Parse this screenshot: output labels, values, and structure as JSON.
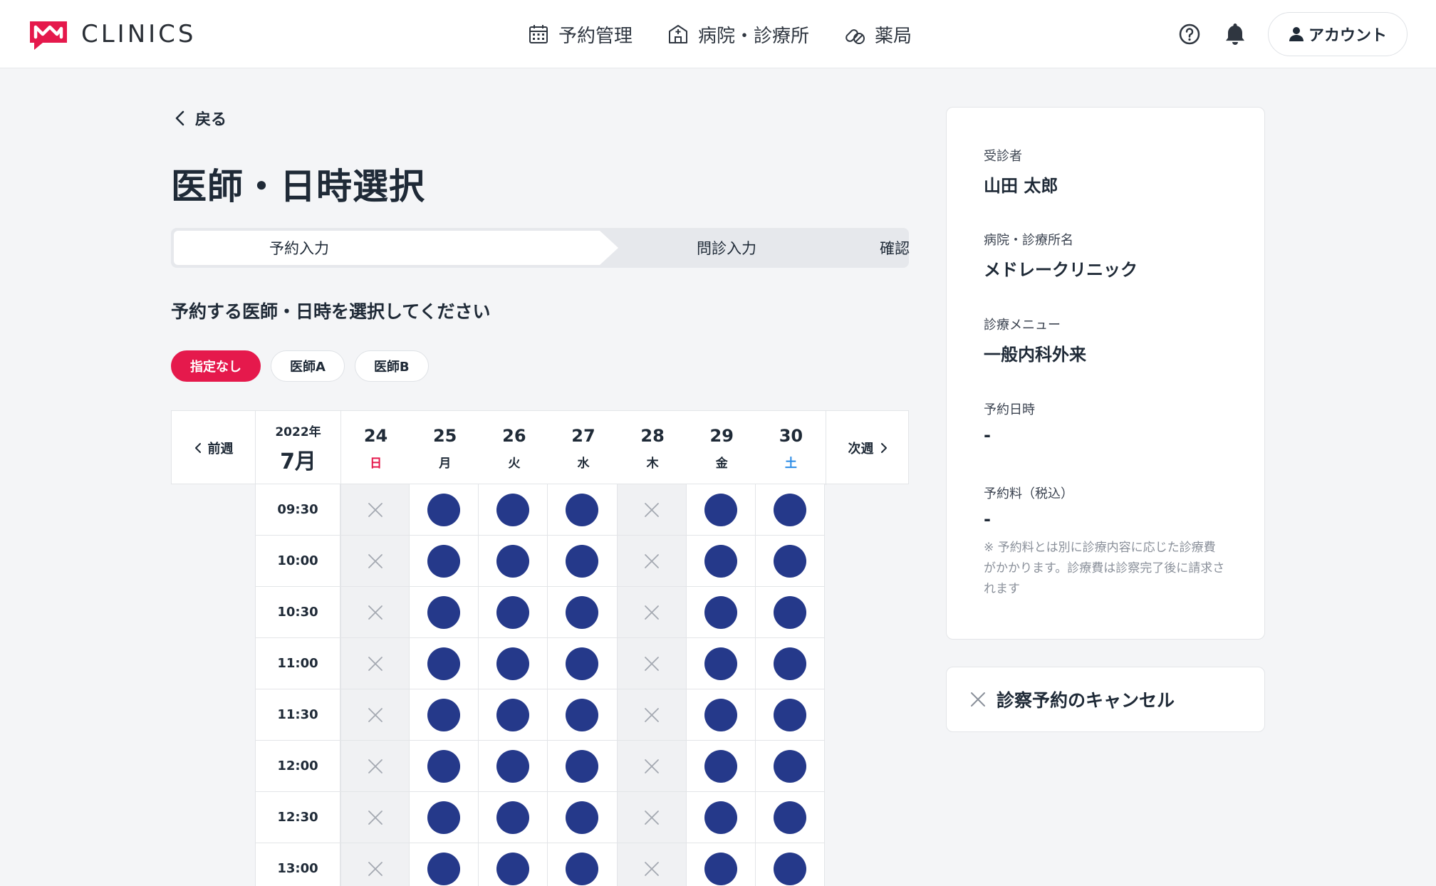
{
  "header": {
    "logo_text": "CLINICS",
    "nav": [
      {
        "label": "予約管理",
        "icon": "calendar-icon"
      },
      {
        "label": "病院・診療所",
        "icon": "hospital-icon"
      },
      {
        "label": "薬局",
        "icon": "pills-icon"
      }
    ],
    "account_label": "アカウント"
  },
  "back_label": "戻る",
  "page_title": "医師・日時選択",
  "steps": [
    "予約入力",
    "問診入力",
    "確認"
  ],
  "subtitle": "予約する医師・日時を選択してください",
  "doctor_chips": [
    "指定なし",
    "医師A",
    "医師B"
  ],
  "calendar": {
    "prev_label": "前週",
    "next_label": "次週",
    "year": "2022年",
    "month": "7月",
    "days": [
      {
        "num": "24",
        "wd": "日",
        "color": "#e5194c",
        "closed": true
      },
      {
        "num": "25",
        "wd": "月",
        "color": "#1f2a37",
        "closed": false
      },
      {
        "num": "26",
        "wd": "火",
        "color": "#1f2a37",
        "closed": false
      },
      {
        "num": "27",
        "wd": "水",
        "color": "#1f2a37",
        "closed": false
      },
      {
        "num": "28",
        "wd": "木",
        "color": "#1f2a37",
        "closed": true
      },
      {
        "num": "29",
        "wd": "金",
        "color": "#1f2a37",
        "closed": false
      },
      {
        "num": "30",
        "wd": "土",
        "color": "#2b8ce6",
        "closed": false
      }
    ],
    "times": [
      "09:30",
      "10:00",
      "10:30",
      "11:00",
      "11:30",
      "12:00",
      "12:30",
      "13:00"
    ]
  },
  "summary": {
    "patient_label": "受診者",
    "patient_value": "山田 太郎",
    "clinic_label": "病院・診療所名",
    "clinic_value": "メドレークリニック",
    "menu_label": "診療メニュー",
    "menu_value": "一般内科外来",
    "datetime_label": "予約日時",
    "datetime_value": "-",
    "fee_label": "予約料（税込）",
    "fee_value": "-",
    "note": "※ 予約料とは別に診療内容に応じた診療費がかかります。診療費は診察完了後に請求されます"
  },
  "cancel_label": "診察予約のキャンセル",
  "colors": {
    "accent": "#e5194c",
    "available": "#25398a",
    "saturday": "#2b8ce6"
  }
}
